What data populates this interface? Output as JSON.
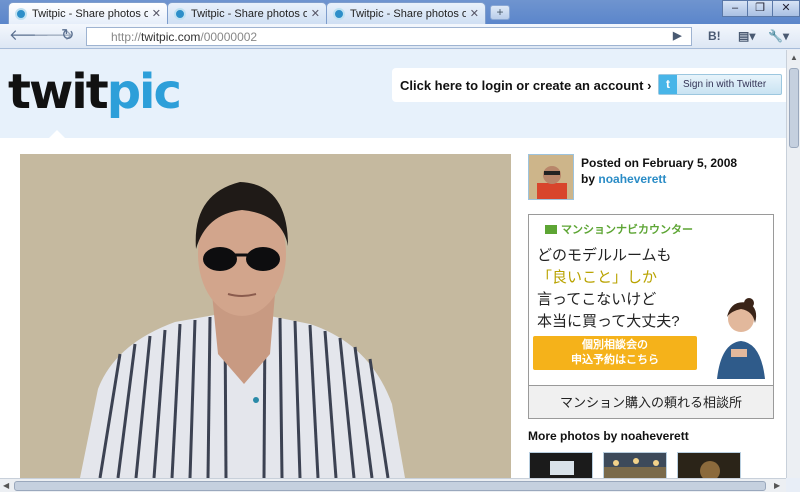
{
  "browser": {
    "tabs": [
      {
        "title": "Twitpic - Share photos on..."
      },
      {
        "title": "Twitpic - Share photos on..."
      },
      {
        "title": "Twitpic - Share photos on..."
      }
    ],
    "address": {
      "scheme": "http://",
      "host": "twitpic.com",
      "path": "/00000002"
    },
    "tb_hatena": "B!"
  },
  "header": {
    "logo_part1": "twit",
    "logo_part2": "pic",
    "login_text": "Click here to login or create an account ›",
    "signin_label": "Sign in with Twitter"
  },
  "post": {
    "posted": "Posted on February 5, 2008",
    "by_prefix": "by",
    "user": "noaheverett"
  },
  "ad": {
    "top": "マンションナビカウンター",
    "line1": "どのモデルルームも",
    "line2": "「良いこと」しか",
    "line3": "言ってこないけど",
    "line4": "本当に買って大丈夫?",
    "button_line1": "個別相談会の",
    "button_line2": "申込予約はこちら",
    "bottom": "マンション購入の頼れる相談所"
  },
  "more_photos": "More photos by noaheverett"
}
